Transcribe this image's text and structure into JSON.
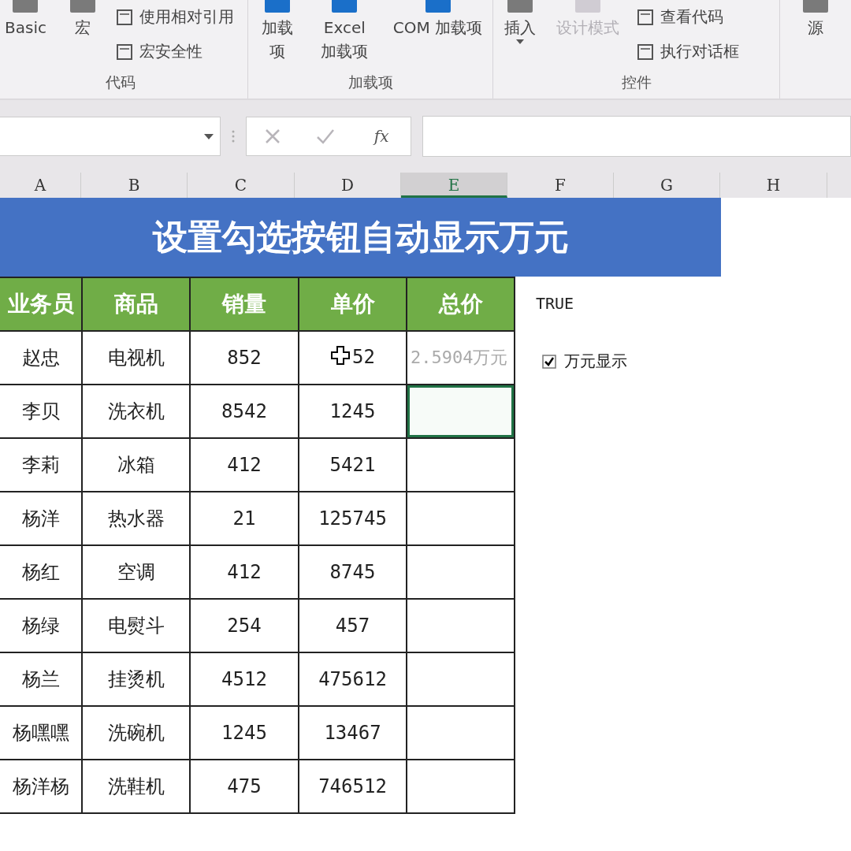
{
  "ribbon": {
    "groups": [
      {
        "label": "代码",
        "items": [
          {
            "kind": "large",
            "label": "Basic",
            "disabled": false
          },
          {
            "kind": "large",
            "label": "宏",
            "disabled": false
          },
          {
            "kind": "small",
            "label": "使用相对引用",
            "disabled": false
          },
          {
            "kind": "small",
            "label": "宏安全性",
            "disabled": false
          }
        ]
      },
      {
        "label": "加载项",
        "items": [
          {
            "kind": "large",
            "label": "加载项",
            "disabled": false
          },
          {
            "kind": "large",
            "label": "Excel 加载项",
            "disabled": false
          },
          {
            "kind": "large",
            "label": "COM 加载项",
            "disabled": false
          }
        ]
      },
      {
        "label": "控件",
        "items": [
          {
            "kind": "dropdown",
            "label": "插入",
            "disabled": false
          },
          {
            "kind": "large",
            "label": "设计模式",
            "disabled": true
          },
          {
            "kind": "small",
            "label": "查看代码",
            "disabled": false
          },
          {
            "kind": "small",
            "label": "执行对话框",
            "disabled": false
          }
        ]
      },
      {
        "items": [
          {
            "kind": "large",
            "label": "源",
            "disabled": false
          }
        ]
      }
    ]
  },
  "formula_bar": {
    "function_button": "fx"
  },
  "columns": [
    {
      "label": "A",
      "selected": false
    },
    {
      "label": "B",
      "selected": false
    },
    {
      "label": "C",
      "selected": false
    },
    {
      "label": "D",
      "selected": false
    },
    {
      "label": "E",
      "selected": true
    },
    {
      "label": "F",
      "selected": false
    },
    {
      "label": "G",
      "selected": false
    },
    {
      "label": "H",
      "selected": false
    }
  ],
  "sheet": {
    "title": "设置勾选按钮自动显示万元",
    "headers": [
      "业务员",
      "商品",
      "销量",
      "单价",
      "总价"
    ],
    "rows": [
      {
        "cells": [
          "赵忠",
          "电视机",
          "852",
          "52"
        ],
        "total": "2.5904万元",
        "selected": false
      },
      {
        "cells": [
          "李贝",
          "洗衣机",
          "8542",
          "1245"
        ],
        "selected": true
      },
      {
        "cells": [
          "李莉",
          "冰箱",
          "412",
          "5421"
        ],
        "selected": false
      },
      {
        "cells": [
          "杨洋",
          "热水器",
          "21",
          "125745"
        ],
        "selected": false
      },
      {
        "cells": [
          "杨红",
          "空调",
          "412",
          "8745"
        ],
        "selected": false
      },
      {
        "cells": [
          "杨绿",
          "电熨斗",
          "254",
          "457"
        ],
        "selected": false
      },
      {
        "cells": [
          "杨兰",
          "挂烫机",
          "4512",
          "475612"
        ],
        "selected": false
      },
      {
        "cells": [
          "杨嘿嘿",
          "洗碗机",
          "1245",
          "13467"
        ],
        "selected": false
      },
      {
        "cells": [
          "杨洋杨",
          "洗鞋机",
          "475",
          "746512"
        ],
        "selected": false
      }
    ]
  },
  "linked_cell": "TRUE",
  "checkbox": {
    "label": "万元显示",
    "checked": true
  }
}
